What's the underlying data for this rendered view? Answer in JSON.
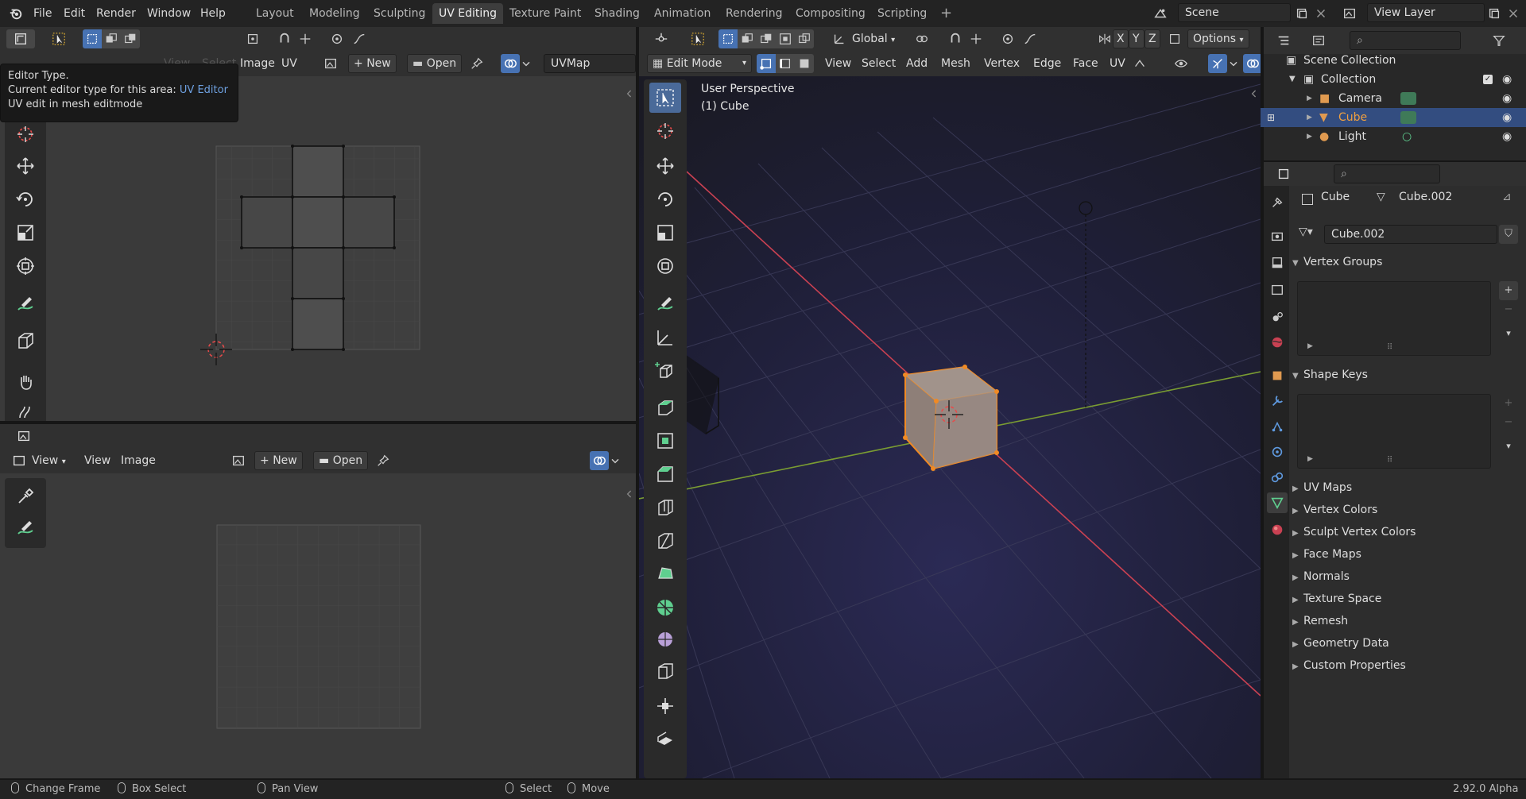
{
  "menu": [
    "File",
    "Edit",
    "Render",
    "Window",
    "Help"
  ],
  "workspaces": [
    "Layout",
    "Modeling",
    "Sculpting",
    "UV Editing",
    "Texture Paint",
    "Shading",
    "Animation",
    "Rendering",
    "Compositing",
    "Scripting"
  ],
  "active_workspace": "UV Editing",
  "scene_name": "Scene",
  "view_layer": "View Layer",
  "tooltip": {
    "title": "Editor Type.",
    "line2_prefix": "Current editor type for this area:",
    "line2_value": "UV Editor",
    "line3": "UV edit in mesh editmode"
  },
  "uv_editor": {
    "header_items": [
      "View",
      "Select",
      "Image",
      "UV"
    ],
    "new_label": "New",
    "open_label": "Open",
    "uvmap": "UVMap"
  },
  "image_editor": {
    "mode": "View",
    "menus": [
      "View",
      "Image"
    ],
    "new_label": "New",
    "open_label": "Open"
  },
  "viewport": {
    "mode": "Edit Mode",
    "menus": [
      "View",
      "Select",
      "Add",
      "Mesh",
      "Vertex",
      "Edge",
      "Face",
      "UV"
    ],
    "orientation": "Global",
    "axes": [
      "X",
      "Y",
      "Z"
    ],
    "options_label": "Options",
    "overlay_title": "User Perspective",
    "overlay_object": "(1) Cube"
  },
  "outliner": {
    "root": "Scene Collection",
    "collection": "Collection",
    "items": [
      "Camera",
      "Cube",
      "Light"
    ]
  },
  "properties": {
    "object": "Cube",
    "mesh": "Cube.002",
    "data_name": "Cube.002",
    "sections_open": [
      "Vertex Groups",
      "Shape Keys"
    ],
    "sections_closed": [
      "UV Maps",
      "Vertex Colors",
      "Sculpt Vertex Colors",
      "Face Maps",
      "Normals",
      "Texture Space",
      "Remesh",
      "Geometry Data",
      "Custom Properties"
    ]
  },
  "status": {
    "change_frame": "Change Frame",
    "box_select": "Box Select",
    "pan_view": "Pan View",
    "select": "Select",
    "move": "Move",
    "version": "2.92.0 Alpha"
  },
  "colors": {
    "accent": "#4772b3",
    "selected_orange": "#f08a24",
    "x_axis": "#c94152",
    "y_axis": "#7a9c32"
  }
}
